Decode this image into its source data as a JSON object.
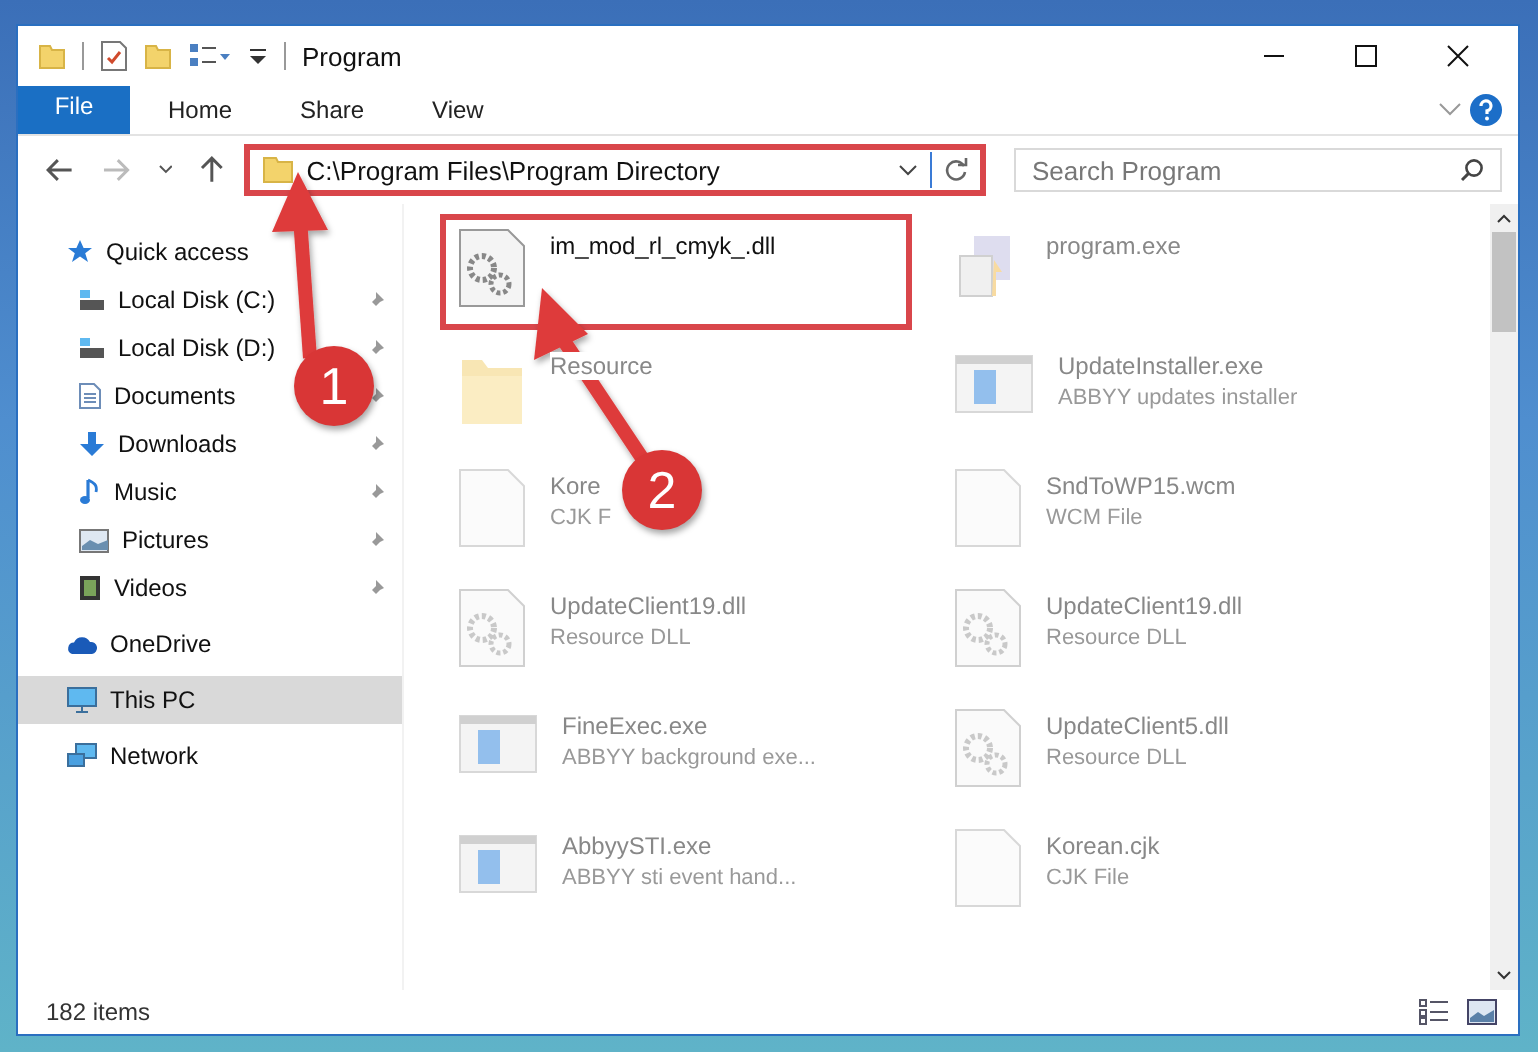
{
  "window": {
    "title": "Program"
  },
  "ribbon_tabs": [
    {
      "label": "File",
      "kind": "file"
    },
    {
      "label": "Home",
      "kind": "tab"
    },
    {
      "label": "Share",
      "kind": "tab"
    },
    {
      "label": "View",
      "kind": "tab"
    }
  ],
  "address_bar": {
    "path": "C:\\Program Files\\Program Directory",
    "highlighted": true
  },
  "search": {
    "placeholder": "Search Program"
  },
  "sidebar": {
    "items": [
      {
        "label": "Quick access",
        "selected": false,
        "children": [
          {
            "label": "Local Disk (C:)",
            "pinned": true
          },
          {
            "label": "Local Disk (D:)",
            "pinned": true
          },
          {
            "label": "Documents",
            "pinned": true
          },
          {
            "label": "Downloads",
            "pinned": true
          },
          {
            "label": "Music",
            "pinned": true
          },
          {
            "label": "Pictures",
            "pinned": true
          },
          {
            "label": "Videos",
            "pinned": true
          }
        ]
      },
      {
        "label": "OneDrive",
        "selected": false
      },
      {
        "label": "This PC",
        "selected": true
      },
      {
        "label": "Network",
        "selected": false
      }
    ]
  },
  "files": [
    {
      "name": "im_mod_rl_cmyk_.dll",
      "kind": "dll",
      "highlighted": true,
      "dimmed": false
    },
    {
      "name": "program.exe",
      "kind": "installer",
      "highlighted": false,
      "dimmed": true
    },
    {
      "name": "Resource",
      "kind": "folder",
      "highlighted": false,
      "dimmed": true
    },
    {
      "name": "UpdateInstaller.exe",
      "subtitle": "ABBYY updates installer",
      "kind": "app",
      "highlighted": false,
      "dimmed": true
    },
    {
      "name": "Kore",
      "subtitle": "CJK F",
      "kind": "blank",
      "highlighted": false,
      "dimmed": true
    },
    {
      "name": "SndToWP15.wcm",
      "subtitle": "WCM File",
      "kind": "blank",
      "highlighted": false,
      "dimmed": true
    },
    {
      "name": "UpdateClient19.dll",
      "subtitle": "Resource DLL",
      "kind": "dll",
      "highlighted": false,
      "dimmed": true
    },
    {
      "name": "UpdateClient19.dll",
      "subtitle": "Resource DLL",
      "kind": "dll",
      "highlighted": false,
      "dimmed": true
    },
    {
      "name": "FineExec.exe",
      "subtitle": "ABBYY background exe...",
      "kind": "app",
      "highlighted": false,
      "dimmed": true
    },
    {
      "name": "UpdateClient5.dll",
      "subtitle": "Resource DLL",
      "kind": "dll",
      "highlighted": false,
      "dimmed": true
    },
    {
      "name": "AbbyySTI.exe",
      "subtitle": "ABBYY sti event hand...",
      "kind": "app",
      "highlighted": false,
      "dimmed": true
    },
    {
      "name": "Korean.cjk",
      "subtitle": "CJK File",
      "kind": "blank",
      "highlighted": false,
      "dimmed": true
    }
  ],
  "callouts": [
    {
      "number": "1"
    },
    {
      "number": "2"
    }
  ],
  "status_bar": {
    "item_count": "182 items"
  }
}
